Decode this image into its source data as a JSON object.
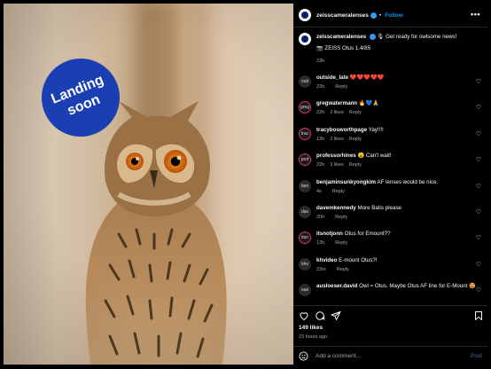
{
  "badge": {
    "text": "Landing\nsoon"
  },
  "header": {
    "username": "zeisscameralenses",
    "separator": "•",
    "follow_label": "Follow",
    "more": "•••"
  },
  "caption": {
    "username": "zeisscameralenses",
    "text": "🎙 Get ready for owlsome news!",
    "line2": "📷 ZEISS Otus 1.4/85",
    "time": "23h"
  },
  "comments": [
    {
      "avatar": "outi",
      "user": "outside_late",
      "text": "❤️❤️❤️❤️❤️",
      "time": "23h",
      "likes": "",
      "reply": "Reply",
      "ring": false
    },
    {
      "avatar": "greg",
      "user": "gregwatermann",
      "text": "🔥💙🙏",
      "time": "22h",
      "likes": "2 likes",
      "reply": "Reply",
      "ring": true
    },
    {
      "avatar": "trac",
      "user": "tracybosworthpage",
      "text": "Yay!!!!",
      "time": "13h",
      "likes": "2 likes",
      "reply": "Reply",
      "ring": true
    },
    {
      "avatar": "prof",
      "user": "professorhines",
      "text": "😮 Can't wait!",
      "time": "22h",
      "likes": "3 likes",
      "reply": "Reply",
      "ring": true
    },
    {
      "avatar": "ben",
      "user": "benjaminsunkyongkim",
      "text": "AF lenses would be nice.",
      "time": "4s",
      "likes": "",
      "reply": "Reply",
      "ring": false
    },
    {
      "avatar": "dav",
      "user": "davemkennedy",
      "text": "More Batis please",
      "time": "20h",
      "likes": "",
      "reply": "Reply",
      "ring": false
    },
    {
      "avatar": "itsn",
      "user": "itsnotjonn",
      "text": "Otus for Emount??",
      "time": "13h",
      "likes": "",
      "reply": "Reply",
      "ring": true
    },
    {
      "avatar": "khv",
      "user": "khvideo",
      "text": "E-mount Otus?!",
      "time": "23m",
      "likes": "",
      "reply": "Reply",
      "ring": false
    },
    {
      "avatar": "aus",
      "user": "ausloeser.david",
      "text": "Owl = Otus. Maybe Otus AF line for E-Mount 🤩",
      "time": "",
      "likes": "",
      "reply": "",
      "ring": false
    }
  ],
  "footer": {
    "likes": "149 likes",
    "ago": "23 hours ago",
    "comment_placeholder": "Add a comment...",
    "post_label": "Post"
  },
  "icons": {
    "heart": "heart-icon",
    "comment": "comment-icon",
    "share": "share-icon",
    "save": "bookmark-icon",
    "emoji": "emoji-icon",
    "more": "more-icon"
  },
  "colors": {
    "badge": "#1a3fb3",
    "follow": "#0095f6",
    "verified": "#3797f0",
    "background": "#000000",
    "muted": "#a8a8a8"
  }
}
